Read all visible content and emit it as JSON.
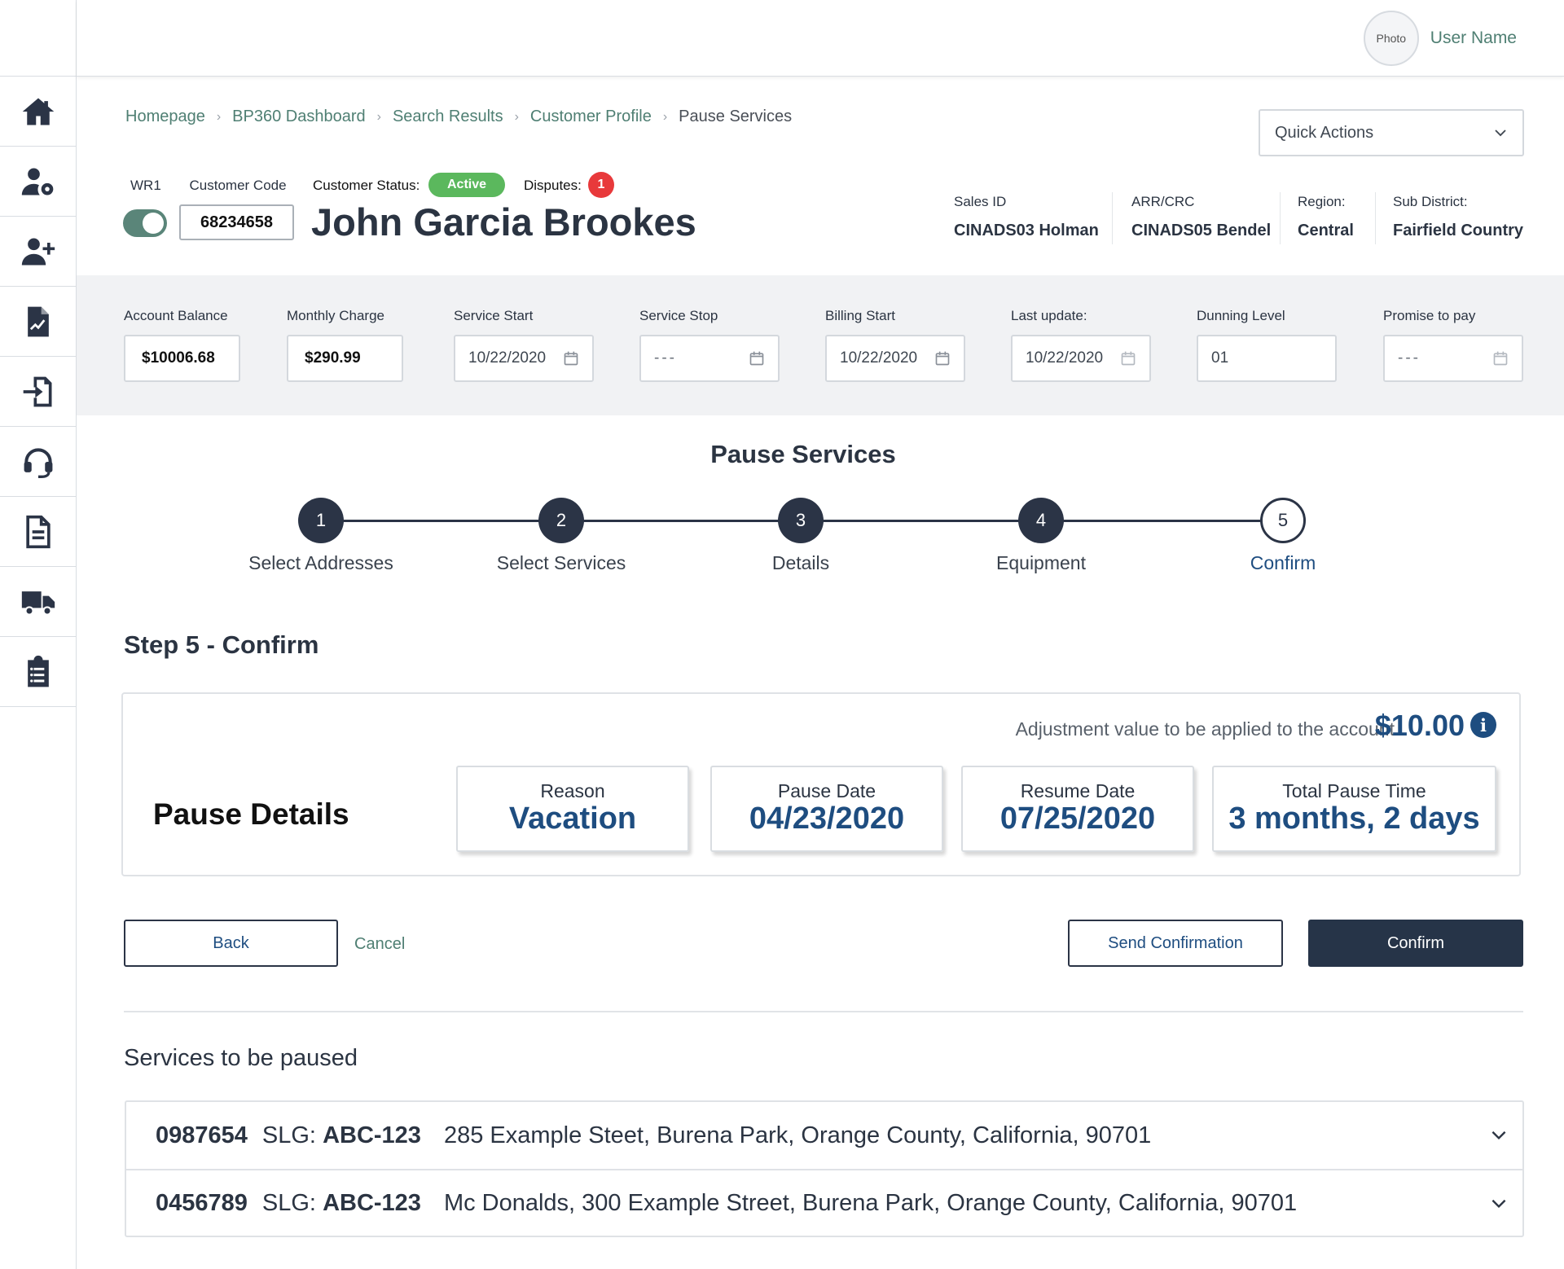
{
  "header": {
    "avatar_text": "Photo",
    "user_name": "User Name"
  },
  "sidebar": {
    "items": [
      {
        "icon": "home-icon"
      },
      {
        "icon": "user-gear-icon"
      },
      {
        "icon": "user-plus-icon"
      },
      {
        "icon": "report-icon"
      },
      {
        "icon": "transfer-icon"
      },
      {
        "icon": "headset-icon"
      },
      {
        "icon": "document-icon"
      },
      {
        "icon": "truck-icon"
      },
      {
        "icon": "clipboard-icon"
      }
    ]
  },
  "breadcrumb": [
    "Homepage",
    "BP360 Dashboard",
    "Search Results",
    "Customer Profile",
    "Pause Services"
  ],
  "quick_actions": {
    "label": "Quick Actions"
  },
  "customer": {
    "wr_label": "WR1",
    "code_label": "Customer Code",
    "code": "68234658",
    "status_label": "Customer Status:",
    "status": "Active",
    "disputes_label": "Disputes:",
    "disputes_count": "1",
    "name": "John Garcia Brookes"
  },
  "meta": [
    {
      "label": "Sales ID",
      "value": "CINADS03 Holman"
    },
    {
      "label": "ARR/CRC",
      "value": "CINADS05 Bendel"
    },
    {
      "label": "Region:",
      "value": "Central"
    },
    {
      "label": "Sub District:",
      "value": "Fairfield Country"
    }
  ],
  "account_fields": [
    {
      "label": "Account Balance",
      "value": "$10006.68"
    },
    {
      "label": "Monthly Charge",
      "value": "$290.99"
    },
    {
      "label": "Service Start",
      "value": "10/22/2020"
    },
    {
      "label": "Service Stop",
      "value": "---"
    },
    {
      "label": "Billing Start",
      "value": "10/22/2020"
    },
    {
      "label": "Last update:",
      "value": "10/22/2020"
    },
    {
      "label": "Dunning Level",
      "value": "01"
    },
    {
      "label": "Promise to pay",
      "value": "---"
    }
  ],
  "stepper": {
    "title": "Pause Services",
    "steps": [
      {
        "number": "1",
        "label": "Select Addresses"
      },
      {
        "number": "2",
        "label": "Select Services"
      },
      {
        "number": "3",
        "label": "Details"
      },
      {
        "number": "4",
        "label": "Equipment"
      },
      {
        "number": "5",
        "label": "Confirm"
      }
    ]
  },
  "confirm": {
    "section_title": "Step 5 - Confirm",
    "adjustment_text": "Adjustment value to be applied to the account",
    "adjustment_value": "$10.00",
    "pause_details_title": "Pause Details",
    "details": [
      {
        "label": "Reason",
        "value": "Vacation"
      },
      {
        "label": "Pause Date",
        "value": "04/23/2020"
      },
      {
        "label": "Resume Date",
        "value": "07/25/2020"
      },
      {
        "label": "Total Pause Time",
        "value": "3 months, 2 days"
      }
    ]
  },
  "buttons": {
    "back": "Back",
    "cancel": "Cancel",
    "send_confirmation": "Send Confirmation",
    "confirm": "Confirm"
  },
  "services": {
    "title": "Services to be paused",
    "slg_label": "SLG:",
    "rows": [
      {
        "id": "0987654",
        "slg": "ABC-123",
        "address": "285 Example Steet, Burena Park, Orange County, California, 90701"
      },
      {
        "id": "0456789",
        "slg": "ABC-123",
        "address": "Mc Donalds, 300 Example Street, Burena Park, Orange County, California, 90701"
      }
    ]
  },
  "colors": {
    "primary_navy": "#263448",
    "accent_blue": "#1e4d80",
    "link_green": "#4f7f73",
    "active_green": "#5bb85d",
    "dispute_red": "#e8393b"
  }
}
